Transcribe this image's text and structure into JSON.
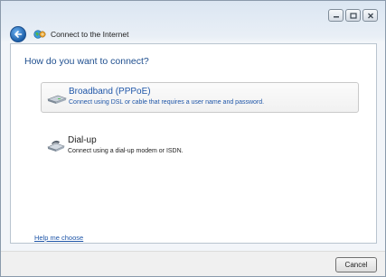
{
  "window": {
    "title": "Connect to the Internet",
    "minimize_icon": "minimize-icon",
    "maximize_icon": "maximize-icon",
    "close_icon": "close-icon"
  },
  "header": {
    "back_icon": "back-arrow-icon",
    "wizard_icon": "network-globe-icon"
  },
  "main": {
    "question": "How do you want to connect?",
    "options": [
      {
        "title": "Broadband (PPPoE)",
        "description": "Connect using DSL or cable that requires a user name and password.",
        "icon": "broadband-modem-icon",
        "selected": true
      },
      {
        "title": "Dial-up",
        "description": "Connect using a dial-up modem or ISDN.",
        "icon": "dialup-modem-icon",
        "selected": false
      }
    ],
    "help_link": "Help me choose"
  },
  "footer": {
    "cancel_label": "Cancel"
  },
  "colors": {
    "link_blue": "#1f56a8",
    "heading_blue": "#1f4f8f"
  }
}
